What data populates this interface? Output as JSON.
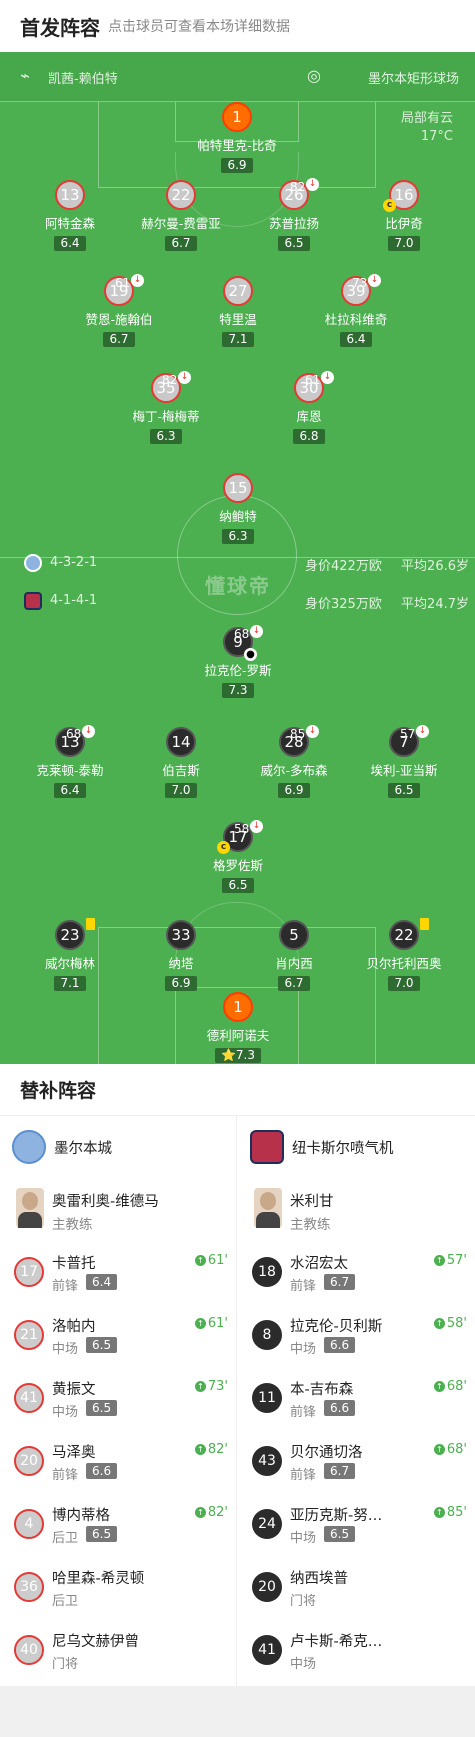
{
  "header": {
    "title": "首发阵容",
    "subtitle": "点击球员可查看本场详细数据"
  },
  "venue": {
    "referee": "凯茜-赖伯特",
    "stadium": "墨尔本矩形球场"
  },
  "weather": {
    "condition": "局部有云",
    "temp": "17°C"
  },
  "watermark": "懂球帝",
  "home_info": {
    "formation": "4-3-2-1",
    "value": "身价422万欧",
    "age": "平均26.6岁"
  },
  "away_info": {
    "formation": "4-1-4-1",
    "value": "身价325万欧",
    "age": "平均24.7岁"
  },
  "home_players": [
    {
      "num": "1",
      "name": "帕特里克-比奇",
      "rating": "6.9"
    },
    {
      "num": "13",
      "name": "阿特金森",
      "rating": "6.4"
    },
    {
      "num": "22",
      "name": "赫尔曼-费雷亚",
      "rating": "6.7"
    },
    {
      "num": "26",
      "name": "苏普拉扬",
      "rating": "6.5",
      "sub": "82'"
    },
    {
      "num": "16",
      "name": "比伊奇",
      "rating": "7.0"
    },
    {
      "num": "19",
      "name": "赞恩-施翰伯",
      "rating": "6.7",
      "sub": "61'"
    },
    {
      "num": "27",
      "name": "特里温",
      "rating": "7.1"
    },
    {
      "num": "39",
      "name": "杜拉科维奇",
      "rating": "6.4",
      "sub": "73'"
    },
    {
      "num": "35",
      "name": "梅丁-梅梅蒂",
      "rating": "6.3",
      "sub": "82'"
    },
    {
      "num": "30",
      "name": "库恩",
      "rating": "6.8",
      "sub": "61'"
    },
    {
      "num": "15",
      "name": "纳鲍特",
      "rating": "6.3"
    }
  ],
  "away_players": [
    {
      "num": "9",
      "name": "拉克伦-罗斯",
      "rating": "7.3",
      "sub": "68'"
    },
    {
      "num": "13",
      "name": "克莱顿-泰勒",
      "rating": "6.4",
      "sub": "68'"
    },
    {
      "num": "14",
      "name": "伯吉斯",
      "rating": "7.0"
    },
    {
      "num": "28",
      "name": "威尔-多布森",
      "rating": "6.9",
      "sub": "85'"
    },
    {
      "num": "7",
      "name": "埃利-亚当斯",
      "rating": "6.5",
      "sub": "57'"
    },
    {
      "num": "17",
      "name": "格罗佐斯",
      "rating": "6.5",
      "sub": "58'"
    },
    {
      "num": "23",
      "name": "威尔梅林",
      "rating": "7.1"
    },
    {
      "num": "33",
      "name": "纳塔",
      "rating": "6.9"
    },
    {
      "num": "5",
      "name": "肖内西",
      "rating": "6.7"
    },
    {
      "num": "22",
      "name": "贝尔托利西奥",
      "rating": "7.0"
    },
    {
      "num": "1",
      "name": "德利阿诺夫",
      "rating": "7.3",
      "star": "⭐"
    }
  ],
  "cap_label": "c",
  "subs": {
    "title": "替补阵容",
    "home": {
      "team": "墨尔本城",
      "coach": {
        "name": "奥雷利奥-维德马",
        "role": "主教练"
      },
      "players": [
        {
          "num": "17",
          "name": "卡普托",
          "pos": "前锋",
          "rating": "6.4",
          "on": "61'"
        },
        {
          "num": "21",
          "name": "洛帕内",
          "pos": "中场",
          "rating": "6.5",
          "on": "61'"
        },
        {
          "num": "41",
          "name": "黄振文",
          "pos": "中场",
          "rating": "6.5",
          "on": "73'"
        },
        {
          "num": "20",
          "name": "马泽奥",
          "pos": "前锋",
          "rating": "6.6",
          "on": "82'"
        },
        {
          "num": "4",
          "name": "博内蒂格",
          "pos": "后卫",
          "rating": "6.5",
          "on": "82'"
        },
        {
          "num": "36",
          "name": "哈里森-希灵顿",
          "pos": "后卫"
        },
        {
          "num": "40",
          "name": "尼乌文赫伊曾",
          "pos": "门将"
        }
      ]
    },
    "away": {
      "team": "纽卡斯尔喷气机",
      "coach": {
        "name": "米利甘",
        "role": "主教练"
      },
      "players": [
        {
          "num": "18",
          "name": "水沼宏太",
          "pos": "前锋",
          "rating": "6.7",
          "on": "57'"
        },
        {
          "num": "8",
          "name": "拉克伦-贝利斯",
          "pos": "中场",
          "rating": "6.6",
          "on": "58'"
        },
        {
          "num": "11",
          "name": "本-吉布森",
          "pos": "前锋",
          "rating": "6.6",
          "on": "68'"
        },
        {
          "num": "43",
          "name": "贝尔通切洛",
          "pos": "前锋",
          "rating": "6.7",
          "on": "68'"
        },
        {
          "num": "24",
          "name": "亚历克斯-努…",
          "pos": "中场",
          "rating": "6.5",
          "on": "85'"
        },
        {
          "num": "20",
          "name": "纳西埃普",
          "pos": "门将"
        },
        {
          "num": "41",
          "name": "卢卡斯-希克…",
          "pos": "中场"
        }
      ]
    }
  },
  "colors": {
    "pitch": "#4caf50",
    "home_border": "#e53935",
    "away_fill": "#2b2b2b",
    "gk": "#ff6d00",
    "sub_in": "#4caf50"
  }
}
